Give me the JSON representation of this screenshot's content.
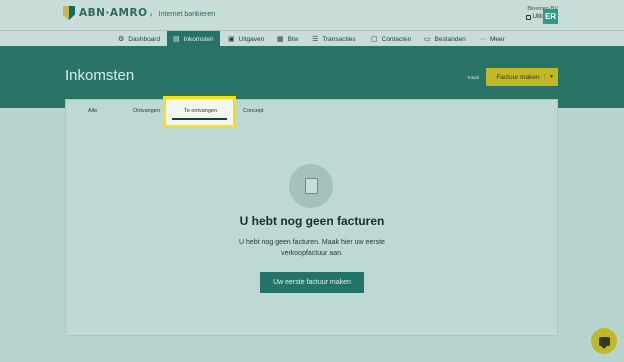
{
  "brand": {
    "name": "ABN·AMRO"
  },
  "header": {
    "back_label": "Internet bankieren",
    "company": "Bloemen BV",
    "logout_label": "Uitloggen",
    "avatar_initials": "ER"
  },
  "nav": {
    "items": [
      {
        "label": "Dashboard",
        "icon": "gear-icon"
      },
      {
        "label": "Inkomsten",
        "icon": "document-icon",
        "active": true
      },
      {
        "label": "Uitgaven",
        "icon": "wallet-icon"
      },
      {
        "label": "Btw",
        "icon": "tax-icon"
      },
      {
        "label": "Transacties",
        "icon": "list-icon"
      },
      {
        "label": "Contacten",
        "icon": "contacts-icon"
      },
      {
        "label": "Bestanden",
        "icon": "folder-icon"
      },
      {
        "label": "Meer",
        "icon": "more-icon"
      }
    ]
  },
  "page": {
    "title": "Inkomsten",
    "totaal_label": "Totaal",
    "primary_button": "Factuur maken"
  },
  "tabs": [
    {
      "label": "Alle"
    },
    {
      "label": "Ontvangen"
    },
    {
      "label": "Te ontvangen",
      "active": true
    },
    {
      "label": "Concept"
    }
  ],
  "empty_state": {
    "title": "U hebt nog geen facturen",
    "text_line1": "U hebt nog geen facturen. Maak hier uw eerste",
    "text_line2": "verkoopfactuur aan.",
    "cta_label": "Uw eerste factuur maken"
  },
  "colors": {
    "primary": "#237466",
    "accent": "#c2b823",
    "highlight": "#f6e10e"
  }
}
